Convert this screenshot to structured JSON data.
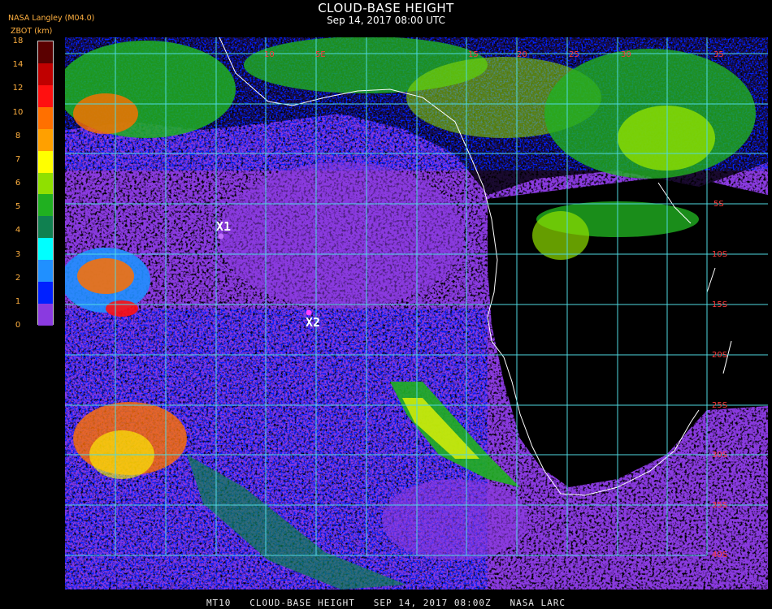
{
  "header": {
    "title": "CLOUD-BASE HEIGHT",
    "subtitle": "Sep 14, 2017 08:00 UTC",
    "org": "NASA Langley (M04.0)",
    "unit": "ZBOT (km)"
  },
  "legend": {
    "ticks": [
      "18",
      "14",
      "12",
      "10",
      "8",
      "7",
      "6",
      "5",
      "4",
      "3",
      "2",
      "1",
      "0"
    ],
    "colors": [
      "#5a0000",
      "#c00000",
      "#ff1010",
      "#ff7000",
      "#ffa000",
      "#ffff00",
      "#90e000",
      "#20b020",
      "#108050",
      "#00ffff",
      "#2090ff",
      "#0020ff",
      "#8a3ae0"
    ]
  },
  "markers": [
    {
      "label": "X1"
    },
    {
      "label": "X2"
    }
  ],
  "grid_labels": {
    "top": [
      "10",
      "5E",
      "10",
      "15",
      "20",
      "25",
      "30",
      "35"
    ],
    "right": [
      "5S",
      "10S",
      "15S",
      "20S",
      "25S",
      "30S",
      "35S",
      "40S"
    ]
  },
  "footer": "MT10   CLOUD-BASE HEIGHT   SEP 14, 2017 08:00Z   NASA LARC",
  "colors": {
    "grid": "#4fd8e0",
    "coast": "#ffffff",
    "label": "#ff3a3a"
  }
}
